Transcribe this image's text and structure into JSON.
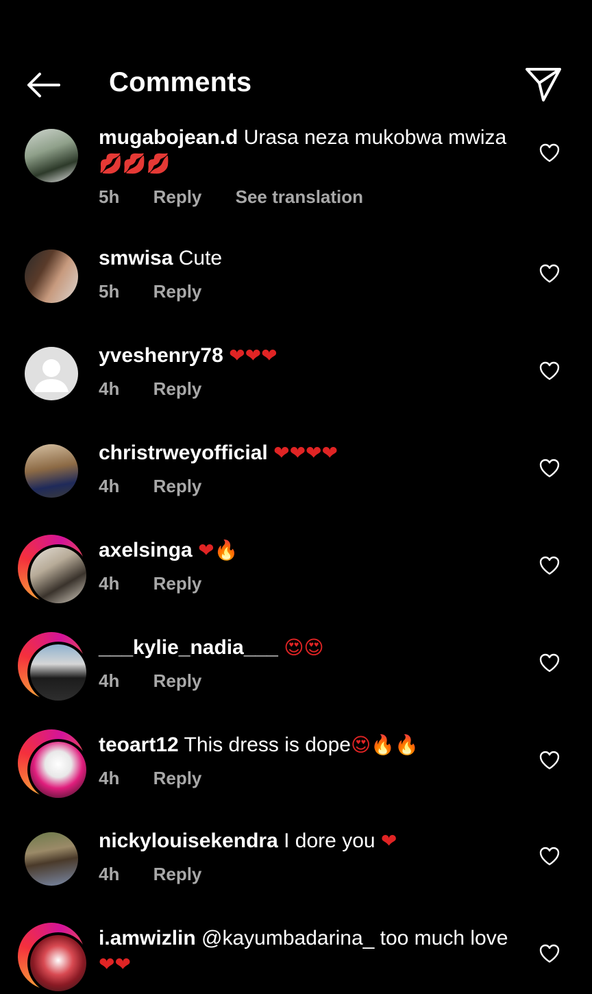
{
  "header": {
    "title": "Comments"
  },
  "comments": [
    {
      "user": "mugabojean.d",
      "text": "Urasa neza mukobwa mwiza",
      "emoji": "💋💋💋",
      "time": "5h",
      "reply": "Reply",
      "translation": "See translation"
    },
    {
      "user": "smwisa",
      "text": "Cute",
      "emoji": "",
      "time": "5h",
      "reply": "Reply"
    },
    {
      "user": "yveshenry78",
      "text": "",
      "emoji": "❤❤❤",
      "time": "4h",
      "reply": "Reply"
    },
    {
      "user": "christrweyofficial",
      "text": "",
      "emoji": "❤❤❤❤",
      "time": "4h",
      "reply": "Reply"
    },
    {
      "user": "axelsinga",
      "text": "",
      "emoji": "❤🔥",
      "time": "4h",
      "reply": "Reply"
    },
    {
      "user": "___kylie_nadia___",
      "text": "",
      "emoji": "😍😍",
      "time": "4h",
      "reply": "Reply"
    },
    {
      "user": "teoart12",
      "text": "This dress is dope",
      "emoji": "😍🔥🔥",
      "time": "4h",
      "reply": "Reply"
    },
    {
      "user": "nickylouisekendra",
      "text": "I dore you",
      "emoji": "❤",
      "time": "4h",
      "reply": "Reply"
    },
    {
      "user": "i.amwizlin",
      "text": "@kayumbadarina_ too much love",
      "emoji": "❤❤",
      "time": "",
      "reply": ""
    }
  ]
}
